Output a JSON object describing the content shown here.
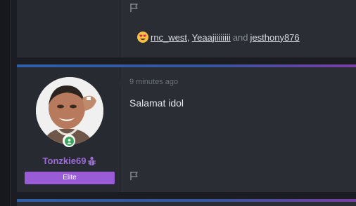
{
  "reactions": {
    "emoji_icon": "heart-eyes-emoji-icon",
    "user1": "rnc_west",
    "user2": "Yeaajiiiiiiii",
    "and_text": "and",
    "user3": "jesthony876"
  },
  "post": {
    "timestamp": "9 minutes ago",
    "message": "Salamat idol",
    "author": {
      "username": "Tonzkie69",
      "rank": "Elite",
      "status_icon": "online-status-icon",
      "badge_icon": "bug-icon"
    }
  },
  "colors": {
    "background": "#1b1d22",
    "card": "#2b2d34",
    "username": "#9b6ad8",
    "rank_badge": "#9a5bd6",
    "accent_start": "#2f5ea8",
    "accent_end": "#7a3fa3",
    "online": "#3ba55d"
  }
}
